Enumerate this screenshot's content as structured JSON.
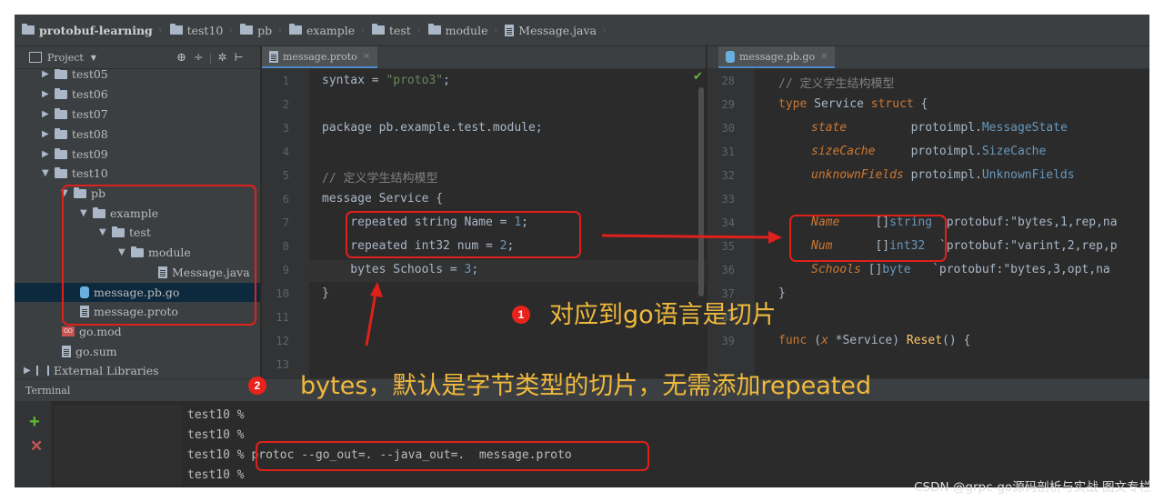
{
  "breadcrumb": [
    "protobuf-learning",
    "test10",
    "pb",
    "example",
    "test",
    "module",
    "Message.java"
  ],
  "project_panel": {
    "title": "Project",
    "toolbar_icons": [
      "target-icon",
      "collapse-icon",
      "gear-icon",
      "hide-icon"
    ]
  },
  "tree": [
    {
      "label": "test05",
      "type": "folder",
      "depth": 1,
      "arrow": "▶"
    },
    {
      "label": "test06",
      "type": "folder",
      "depth": 1,
      "arrow": "▶"
    },
    {
      "label": "test07",
      "type": "folder",
      "depth": 1,
      "arrow": "▶"
    },
    {
      "label": "test08",
      "type": "folder",
      "depth": 1,
      "arrow": "▶"
    },
    {
      "label": "test09",
      "type": "folder",
      "depth": 1,
      "arrow": "▶"
    },
    {
      "label": "test10",
      "type": "folder",
      "depth": 1,
      "arrow": "▼"
    },
    {
      "label": "pb",
      "type": "folder",
      "depth": 2,
      "arrow": "▼"
    },
    {
      "label": "example",
      "type": "folder",
      "depth": 3,
      "arrow": "▼"
    },
    {
      "label": "test",
      "type": "folder",
      "depth": 4,
      "arrow": "▼"
    },
    {
      "label": "module",
      "type": "folder",
      "depth": 5,
      "arrow": "▼"
    },
    {
      "label": "Message.java",
      "type": "file",
      "depth": 6
    },
    {
      "label": "message.pb.go",
      "type": "gofile",
      "depth": 2,
      "selected": true
    },
    {
      "label": "message.proto",
      "type": "file",
      "depth": 2
    },
    {
      "label": "go.mod",
      "type": "mod",
      "depth": 1
    },
    {
      "label": "go.sum",
      "type": "file",
      "depth": 1
    },
    {
      "label": "External Libraries",
      "type": "lib",
      "depth": 0,
      "arrow": "▶"
    }
  ],
  "left_tab": "message.proto",
  "right_tab": "message.pb.go",
  "left_code": {
    "line_numbers": [
      "1",
      "2",
      "3",
      "4",
      "5",
      "6",
      "7",
      "8",
      "9",
      "10",
      "11",
      "12",
      "13"
    ],
    "l1": "syntax = ",
    "l1s": "\"proto3\"",
    "l1e": ";",
    "l3": "package pb.example.test.module;",
    "l5": "// 定义学生结构模型",
    "l6": "message Service {",
    "l7a": "    repeated string Name = ",
    "l7n": "1",
    "l7e": ";",
    "l8a": "    repeated int32 num = ",
    "l8n": "2",
    "l8e": ";",
    "l9a": "    bytes Schools = ",
    "l9n": "3",
    "l9e": ";",
    "l10": "}"
  },
  "right_code": {
    "line_numbers": [
      "28",
      "29",
      "30",
      "31",
      "32",
      "33",
      "34",
      "35",
      "36",
      "37",
      "38",
      "39"
    ],
    "l28": "// 定义学生结构模型",
    "l29a": "type ",
    "l29b": "Service ",
    "l29c": "struct",
    "l29d": " {",
    "l30f": "state",
    "l30t": "         protoimpl.",
    "l30x": "MessageState",
    "l31f": "sizeCache",
    "l31t": "     protoimpl.",
    "l31x": "SizeCache",
    "l32f": "unknownFields",
    "l32t": " protoimpl.",
    "l32x": "UnknownFields",
    "l34f": "Name",
    "l34t": "     []",
    "l34x": "string",
    "l34s": " `protobuf:\"bytes,1,rep,na",
    "l35f": "Num",
    "l35t": "      []",
    "l35x": "int32",
    "l35s": "  `protobuf:\"varint,2,rep,p",
    "l36f": "Schools",
    "l36t": " []",
    "l36x": "byte",
    "l36s": "   `protobuf:\"bytes,3,opt,na",
    "l37": "}",
    "l39a": "func ",
    "l39b": "(",
    "l39c": "x",
    "l39d": " *Service) ",
    "l39e": "Reset",
    "l39f": "() {"
  },
  "terminal": {
    "title": "Terminal",
    "lines": [
      "test10 %",
      "test10 %",
      "test10 % protoc --go_out=. --java_out=.  message.proto",
      "test10 %"
    ]
  },
  "annotations": {
    "a1_num": "1",
    "a1_text": "对应到go语言是切片",
    "a2_num": "2",
    "a2_text": "bytes，默认是字节类型的切片，无需添加repeated"
  },
  "watermark": "CSDN @grpc-go源码剖析与实战 图文专栏",
  "colors": {
    "annotation": "#f0b93c",
    "highlight_box": "#e0201b",
    "badge": "#e8231e"
  }
}
